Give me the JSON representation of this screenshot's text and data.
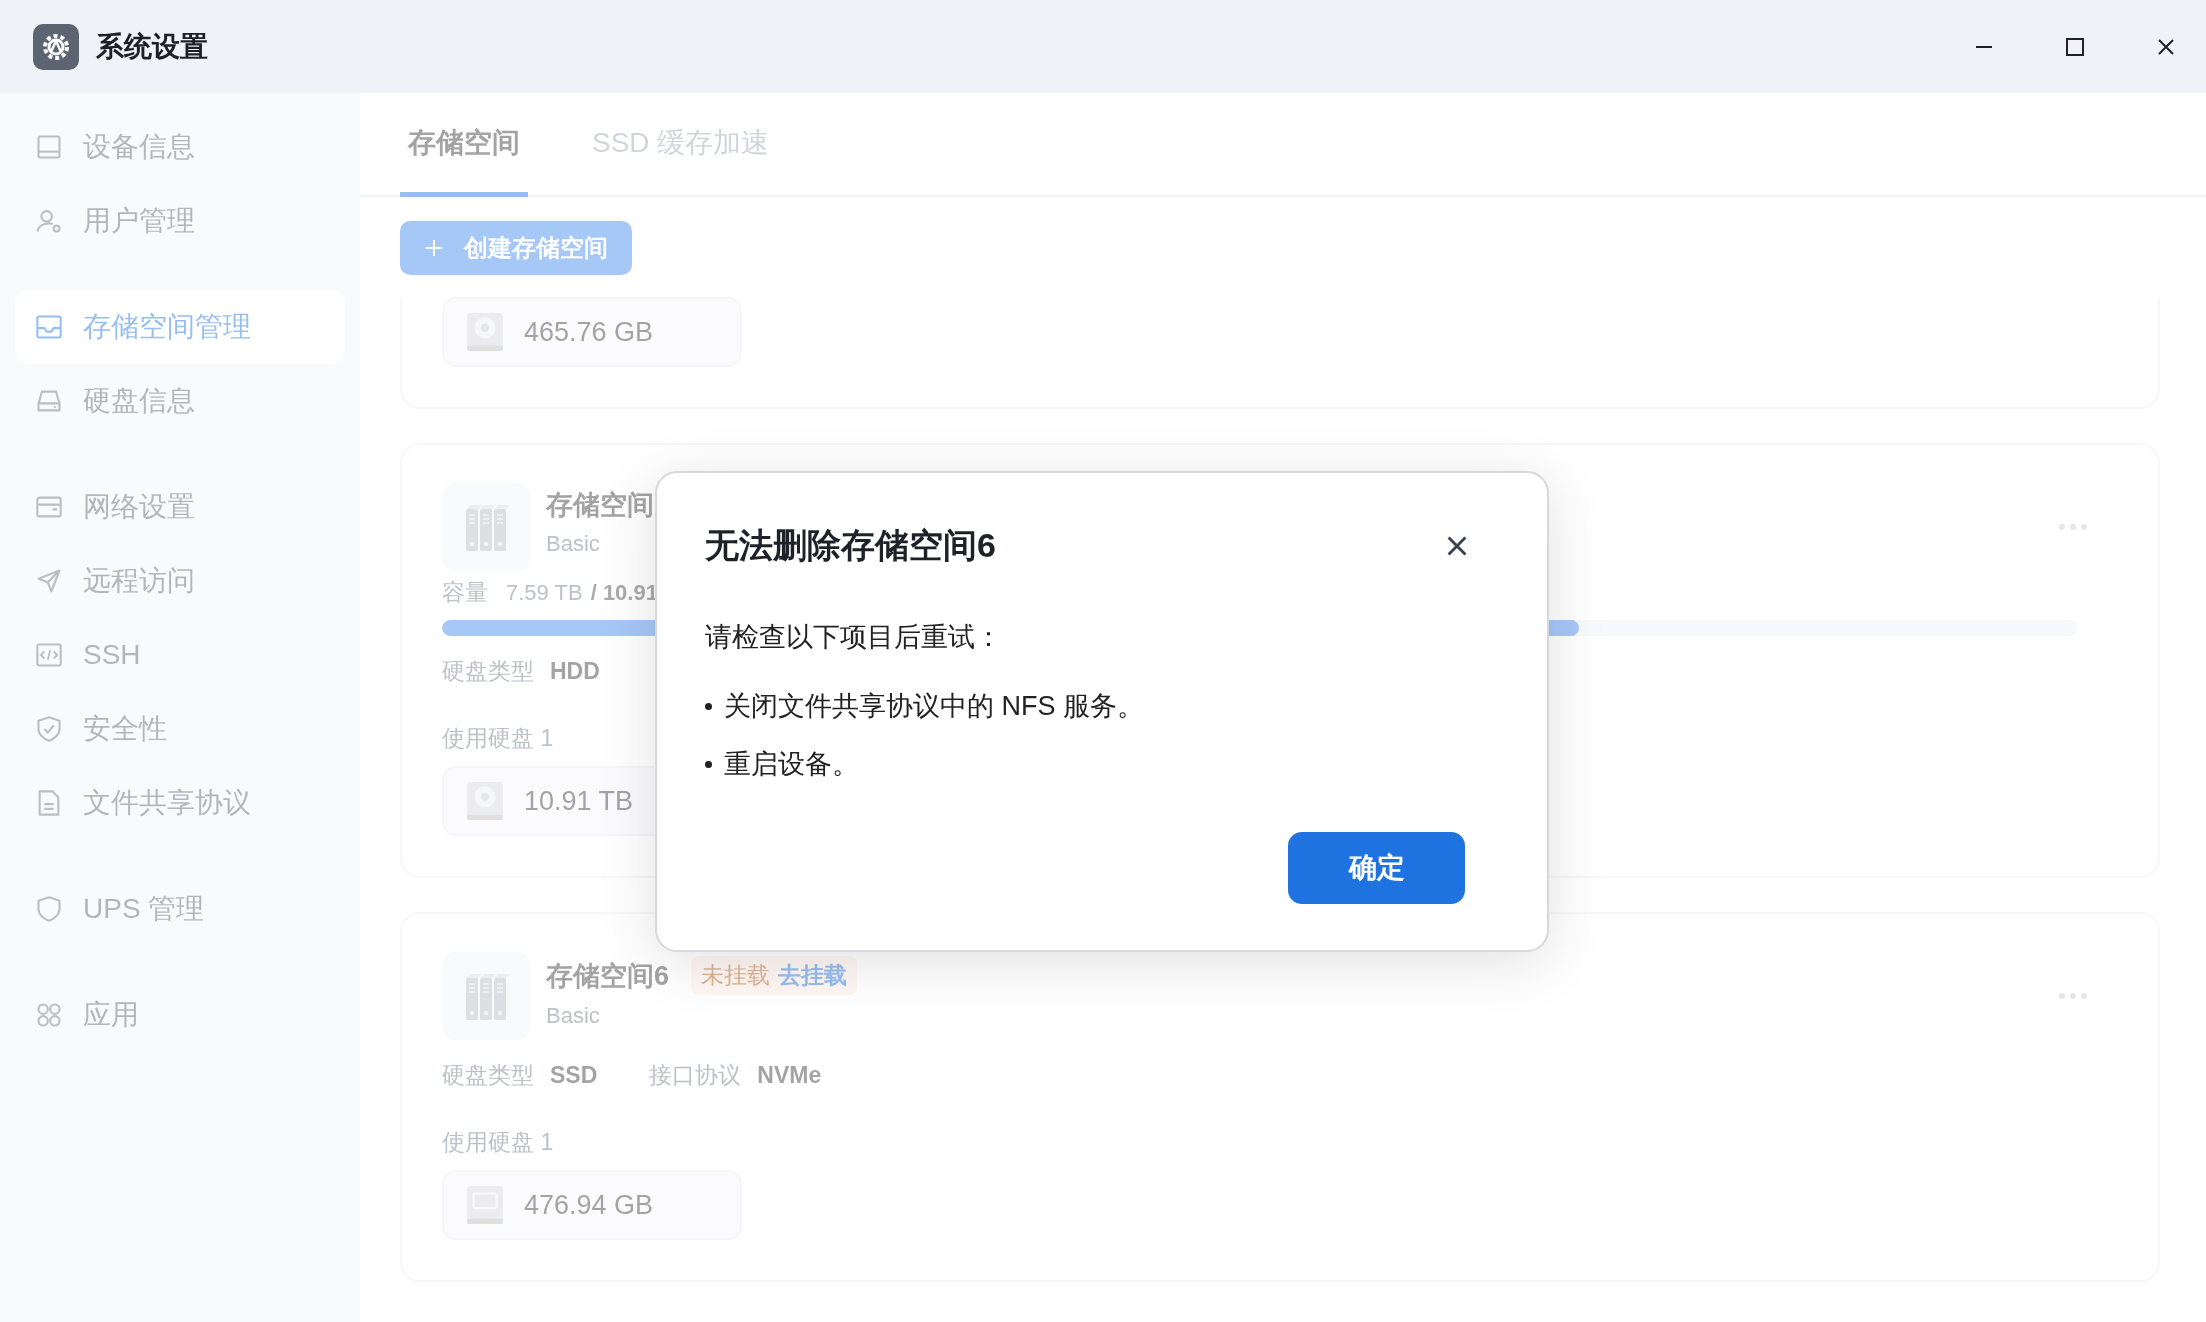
{
  "window": {
    "title": "系统设置"
  },
  "sidebar": {
    "groups": [
      {
        "items": [
          {
            "kind": "device",
            "label": "设备信息",
            "selected": false
          },
          {
            "kind": "user",
            "label": "用户管理",
            "selected": false
          }
        ]
      },
      {
        "items": [
          {
            "kind": "storage",
            "label": "存储空间管理",
            "selected": true
          },
          {
            "kind": "disk",
            "label": "硬盘信息",
            "selected": false
          }
        ]
      },
      {
        "items": [
          {
            "kind": "network",
            "label": "网络设置",
            "selected": false
          },
          {
            "kind": "remote",
            "label": "远程访问",
            "selected": false
          },
          {
            "kind": "ssh",
            "label": "SSH",
            "selected": false
          },
          {
            "kind": "security",
            "label": "安全性",
            "selected": false
          },
          {
            "kind": "file",
            "label": "文件共享协议",
            "selected": false
          }
        ]
      },
      {
        "items": [
          {
            "kind": "ups",
            "label": "UPS 管理",
            "selected": false
          }
        ]
      },
      {
        "items": [
          {
            "kind": "apps",
            "label": "应用",
            "selected": false
          }
        ]
      }
    ]
  },
  "tabs": [
    {
      "label": "存储空间",
      "selected": true
    },
    {
      "label": "SSD 缓存加速",
      "selected": false
    }
  ],
  "create_button": {
    "label": "创建存储空间"
  },
  "pools": [
    {
      "disks": [
        {
          "kind": "hdd",
          "size": "465.76 GB"
        }
      ]
    },
    {
      "name": "存储空间",
      "raid": "Basic",
      "capacity_label": "容量",
      "used": "7.59 TB",
      "total": "/ 10.91",
      "level": 0.695,
      "details": [
        {
          "label": "硬盘类型",
          "value": "HDD"
        }
      ],
      "disks_label": "使用硬盘 1",
      "disks": [
        {
          "kind": "hdd",
          "size": "10.91 TB"
        }
      ]
    },
    {
      "name": "存储空间6",
      "status": {
        "label": "未挂载",
        "action": "去挂载"
      },
      "raid": "Basic",
      "details": [
        {
          "label": "硬盘类型",
          "value": "SSD"
        },
        {
          "label": "接口协议",
          "value": "NVMe"
        }
      ],
      "disks_label": "使用硬盘 1",
      "disks": [
        {
          "kind": "ssd",
          "size": "476.94 GB"
        }
      ]
    }
  ],
  "dialog": {
    "title": "无法删除存储空间6",
    "message": "请检查以下项目后重试：",
    "items": [
      "关闭文件共享协议中的 NFS 服务。",
      "重启设备。"
    ],
    "button": "确定"
  }
}
